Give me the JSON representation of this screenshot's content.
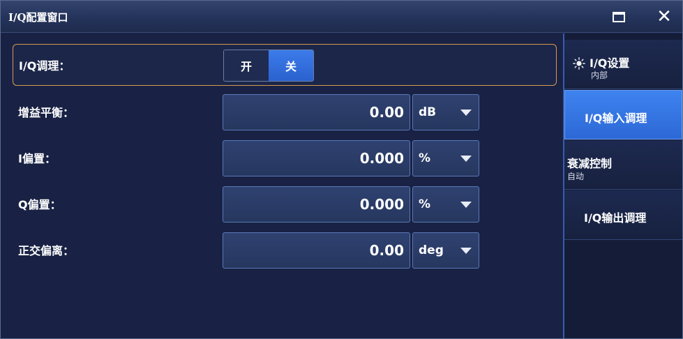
{
  "window": {
    "title": "I/Q配置窗口",
    "controls": {
      "maximize_icon": "maximize-icon",
      "close_symbol": "✕"
    }
  },
  "iq_modulation": {
    "label": "I/Q调理：",
    "options": [
      "开",
      "关"
    ],
    "selected": "关"
  },
  "fields": [
    {
      "label": "增益平衡：",
      "value": "0.00",
      "unit": "dB"
    },
    {
      "label": "I偏置：",
      "value": "0.000",
      "unit": "%"
    },
    {
      "label": "Q偏置：",
      "value": "0.000",
      "unit": "%"
    },
    {
      "label": "正交偏离：",
      "value": "0.00",
      "unit": "deg"
    }
  ],
  "sidebar": {
    "items": [
      {
        "label": "I/Q设置",
        "sub": "内部",
        "icon": "sun-icon",
        "selected": false
      },
      {
        "label": "I/Q输入调理",
        "sub": "",
        "selected": true
      },
      {
        "label": "衰减控制",
        "sub": "自动",
        "selected": false
      },
      {
        "label": "I/Q输出调理",
        "sub": "",
        "selected": false
      }
    ]
  },
  "colors": {
    "accent": "#2f6fdc",
    "active_border": "#d89a50",
    "background": "#192244"
  }
}
